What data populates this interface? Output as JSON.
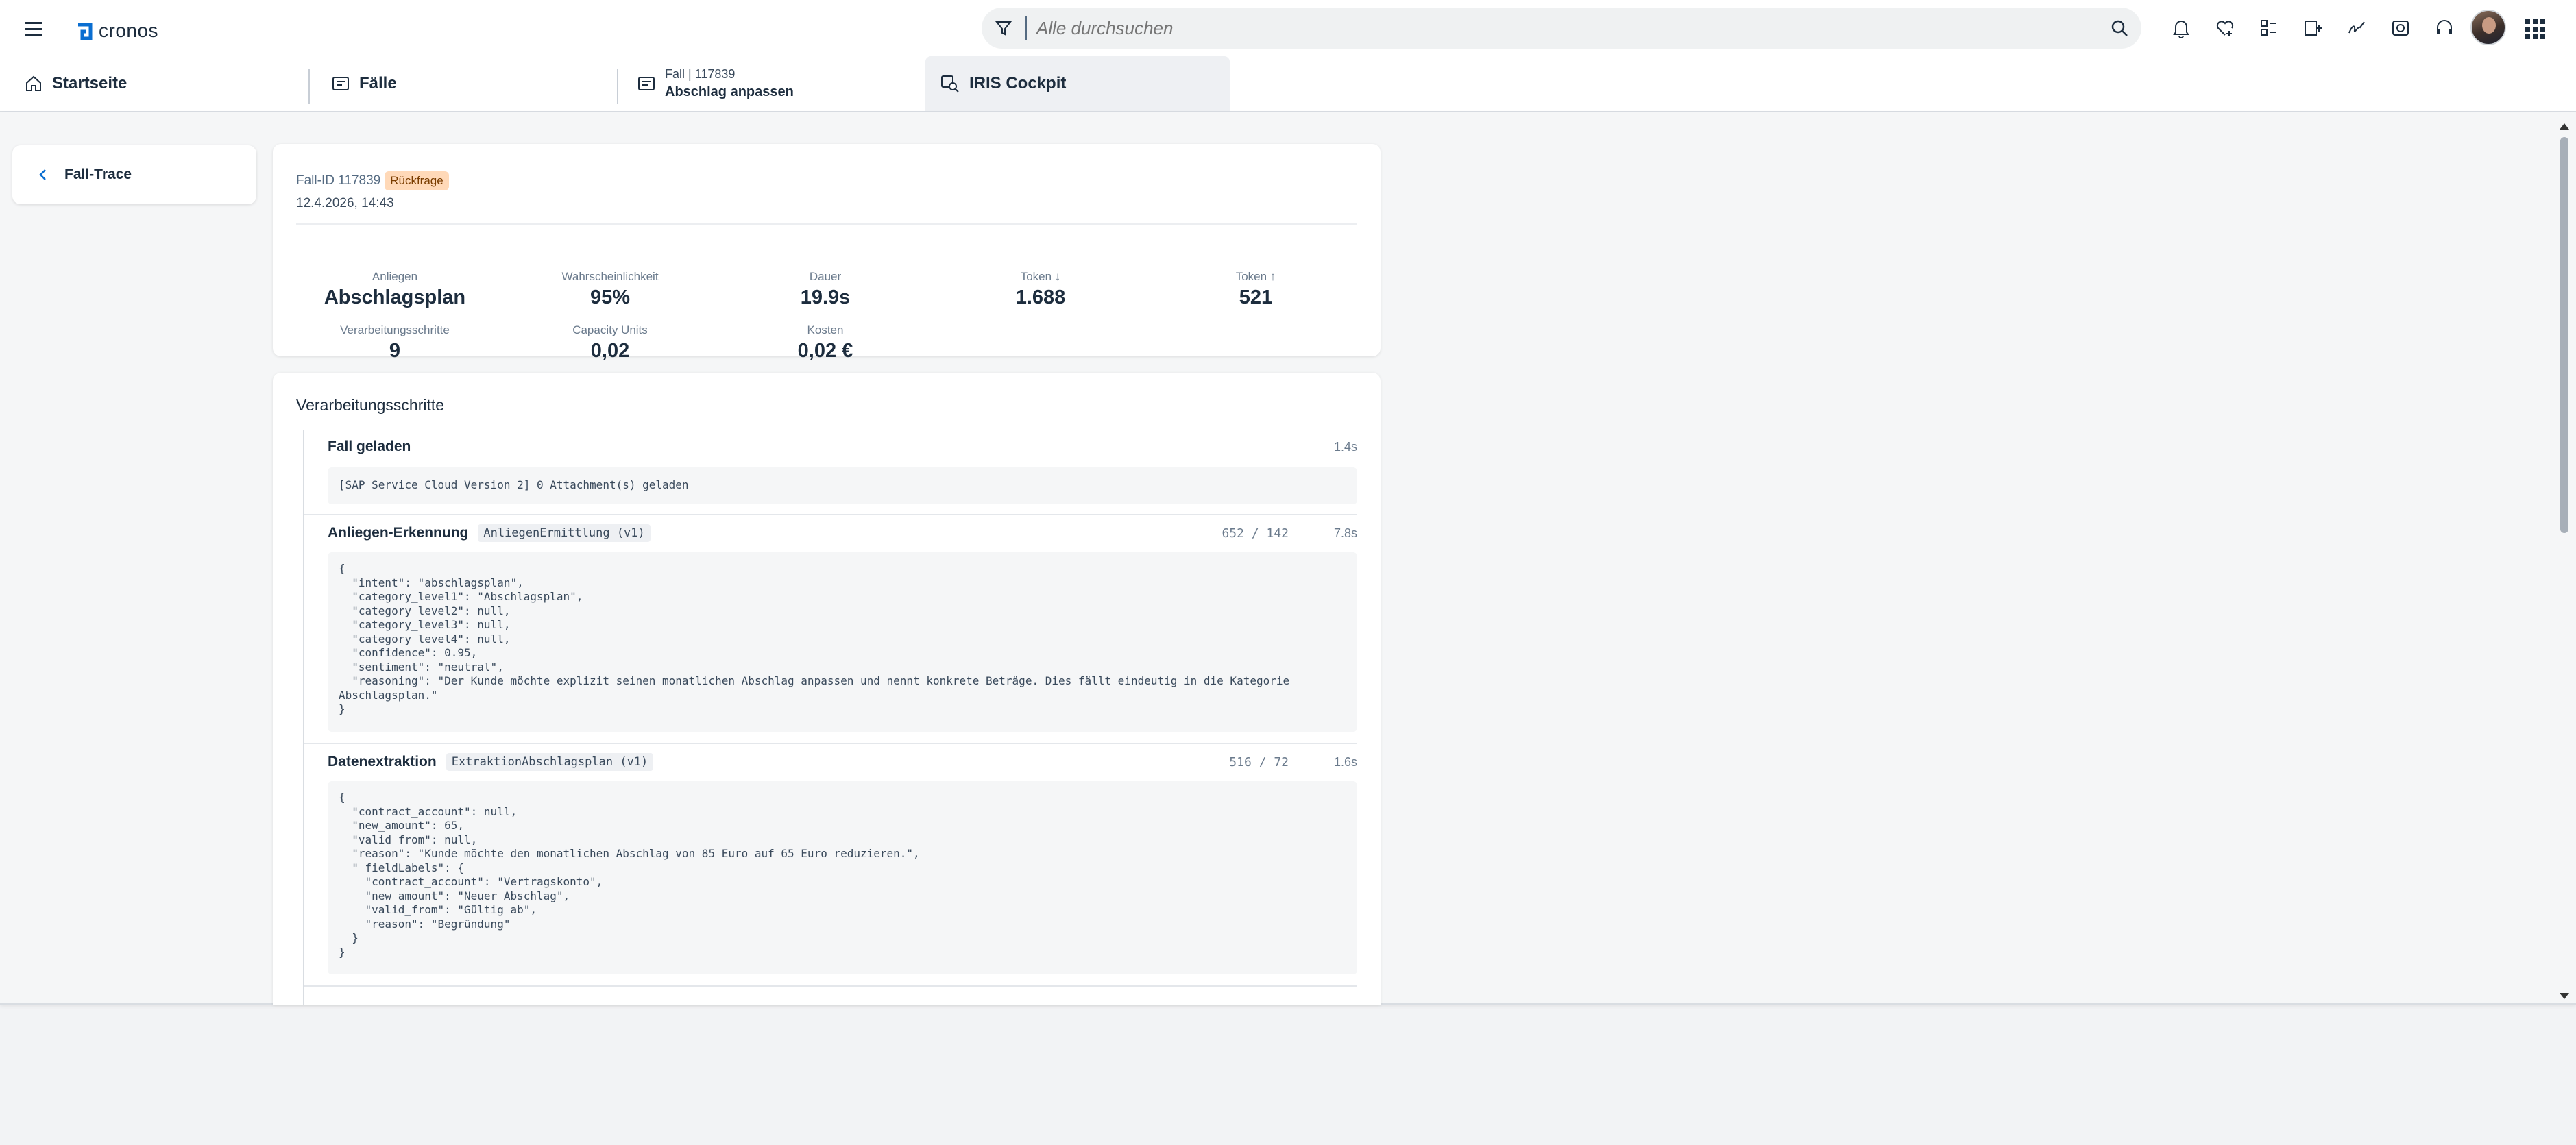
{
  "shell": {
    "logo_text": "cronos",
    "search_placeholder": "Alle durchsuchen",
    "icons": [
      "bell-icon",
      "heart-plus-icon",
      "task-list-icon",
      "add-document-icon",
      "signature-icon",
      "verified-icon",
      "headset-icon"
    ]
  },
  "tabs": [
    {
      "label": "Startseite",
      "icon": "home-icon"
    },
    {
      "label": "Fälle",
      "icon": "case-icon"
    },
    {
      "small": "Fall | 117839",
      "label": "Abschlag anpassen",
      "icon": "case-icon"
    },
    {
      "label": "IRIS Cockpit",
      "icon": "cockpit-search-icon"
    }
  ],
  "nav": {
    "back_label": "Fall-Trace"
  },
  "summary": {
    "case_id": "Fall-ID 117839",
    "status": "Rückfrage",
    "datetime": "12.4.2026, 14:43",
    "stats": [
      {
        "label": "Anliegen",
        "value": "Abschlagsplan"
      },
      {
        "label": "Wahrscheinlichkeit",
        "value": "95%"
      },
      {
        "label": "Dauer",
        "value": "19.9s"
      },
      {
        "label": "Token ↓",
        "value": "1.688"
      },
      {
        "label": "Token ↑",
        "value": "521"
      },
      {
        "label": "Verarbeitungsschritte",
        "value": "9"
      },
      {
        "label": "Capacity Units",
        "value": "0,02"
      },
      {
        "label": "Kosten",
        "value": "0,02 €"
      }
    ]
  },
  "steps": {
    "title": "Verarbeitungsschritte",
    "items": [
      {
        "name": "Fall geladen",
        "tag": "",
        "tokens": "",
        "duration": "1.4s",
        "lines": [
          "[SAP Service Cloud Version 2] 0 Attachment(s) geladen"
        ]
      },
      {
        "name": "Anliegen-Erkennung",
        "tag": "AnliegenErmittlung (v1)",
        "tokens": "652 / 142",
        "duration": "7.8s",
        "lines": [
          "{",
          "  \"intent\": \"abschlagsplan\",",
          "  \"category_level1\": \"Abschlagsplan\",",
          "  \"category_level2\": null,",
          "  \"category_level3\": null,",
          "  \"category_level4\": null,",
          "  \"confidence\": 0.95,",
          "  \"sentiment\": \"neutral\",",
          "  \"reasoning\": \"Der Kunde möchte explizit seinen monatlichen Abschlag anpassen und nennt konkrete Beträge. Dies fällt eindeutig in die Kategorie",
          "Abschlagsplan.\"",
          "}"
        ]
      },
      {
        "name": "Datenextraktion",
        "tag": "ExtraktionAbschlagsplan (v1)",
        "tokens": "516 / 72",
        "duration": "1.6s",
        "lines": [
          "{",
          "  \"contract_account\": null,",
          "  \"new_amount\": 65,",
          "  \"valid_from\": null,",
          "  \"reason\": \"Kunde möchte den monatlichen Abschlag von 85 Euro auf 65 Euro reduzieren.\",",
          "  \"_fieldLabels\": {",
          "    \"contract_account\": \"Vertragskonto\",",
          "    \"new_amount\": \"Neuer Abschlag\",",
          "    \"valid_from\": \"Gültig ab\",",
          "    \"reason\": \"Begründung\"",
          "  }",
          "}"
        ]
      }
    ]
  },
  "colors": {
    "accent": "#0a6ed1",
    "badge_bg": "#ffd9b8",
    "text": "#1d2d3e"
  }
}
